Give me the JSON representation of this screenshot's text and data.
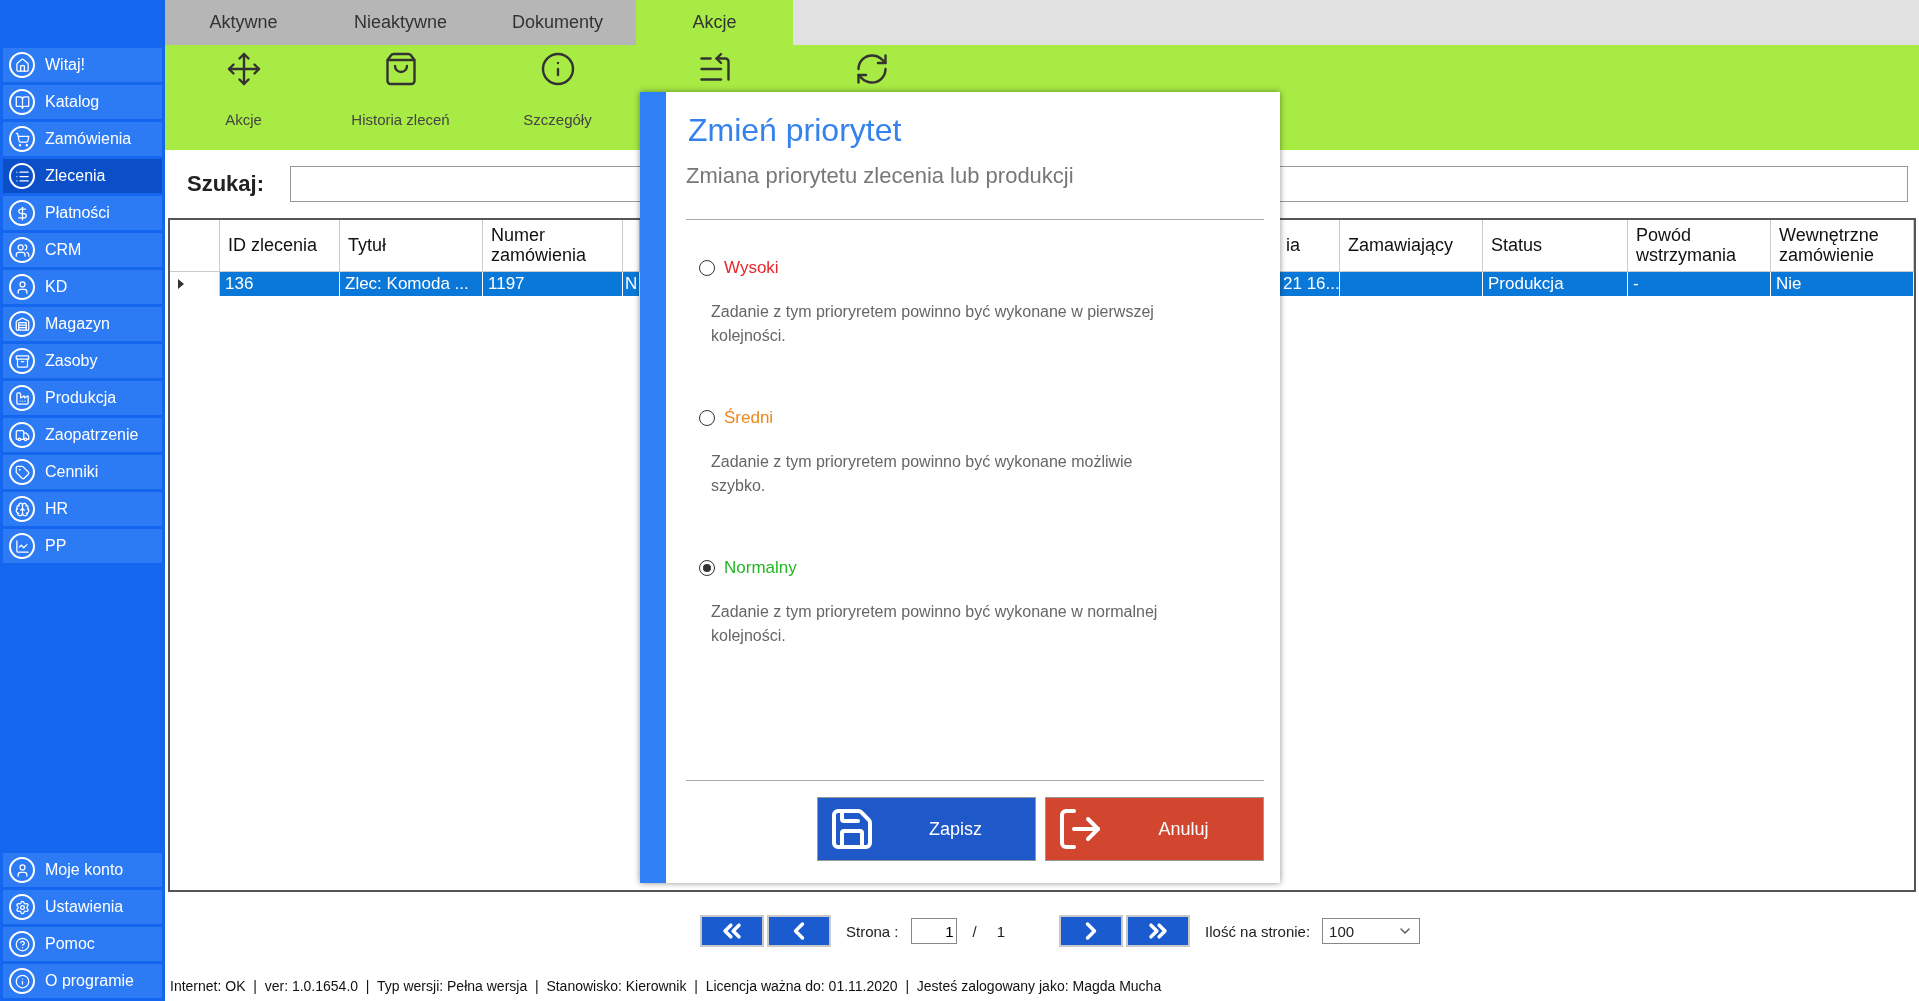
{
  "sidebar": {
    "items": [
      {
        "label": "Witaj!",
        "selected": false
      },
      {
        "label": "Katalog",
        "selected": false
      },
      {
        "label": "Zamówienia",
        "selected": false
      },
      {
        "label": "Zlecenia",
        "selected": true
      },
      {
        "label": "Płatności",
        "selected": false
      },
      {
        "label": "CRM",
        "selected": false
      },
      {
        "label": "KD",
        "selected": false
      },
      {
        "label": "Magazyn",
        "selected": false
      },
      {
        "label": "Zasoby",
        "selected": false
      },
      {
        "label": "Produkcja",
        "selected": false
      },
      {
        "label": "Zaopatrzenie",
        "selected": false
      },
      {
        "label": "Cenniki",
        "selected": false
      },
      {
        "label": "HR",
        "selected": false
      },
      {
        "label": "PP",
        "selected": false
      }
    ],
    "bottom_items": [
      {
        "label": "Moje konto",
        "selected": false
      },
      {
        "label": "Ustawienia",
        "selected": false
      },
      {
        "label": "Pomoc",
        "selected": false
      },
      {
        "label": "O programie",
        "selected": false
      }
    ]
  },
  "tabs": [
    {
      "label": "Aktywne",
      "selected": false
    },
    {
      "label": "Nieaktywne",
      "selected": false
    },
    {
      "label": "Dokumenty",
      "selected": false
    },
    {
      "label": "Akcje",
      "selected": true
    }
  ],
  "toolbar": {
    "labels": [
      "Akcje",
      "Historia zleceń",
      "Szczegóły"
    ]
  },
  "search": {
    "label": "Szukaj:"
  },
  "table": {
    "columns": [
      null,
      "ID zlecenia",
      "Tytuł",
      "Numer zamówienia",
      null,
      null,
      "ia",
      "Zamawiający",
      "Status",
      "Powód wstrzymania",
      "Wewnętrzne zamówienie"
    ],
    "rows": [
      {
        "selected": true,
        "cells": [
          null,
          "136",
          "Zlec: Komoda ...",
          "1197",
          "N",
          null,
          "21 16...",
          null,
          "Produkcja",
          "-",
          "Nie"
        ]
      }
    ]
  },
  "dialog": {
    "title": "Zmień priorytet",
    "subtitle": "Zmiana priorytetu zlecenia lub produkcji",
    "options": [
      {
        "label": "Wysoki",
        "color": "#e8262a",
        "selected": false,
        "description": "Zadanie z tym prioryretem powinno być wykonane w pierwszej kolejności."
      },
      {
        "label": "Średni",
        "color": "#f0861a",
        "selected": false,
        "description": "Zadanie z tym prioryretem powinno być wykonane możliwie szybko."
      },
      {
        "label": "Normalny",
        "color": "#22b822",
        "selected": true,
        "description": "Zadanie z tym prioryretem powinno być wykonane w normalnej kolejności."
      }
    ],
    "buttons": [
      {
        "label": "Zapisz",
        "kind": "save"
      },
      {
        "label": "Anuluj",
        "kind": "cancel"
      }
    ]
  },
  "pagination": {
    "page_label": "Strona :",
    "page": "1",
    "separator": "/",
    "total": "1",
    "per_page_label": "Ilość na stronie:",
    "per_page": "100"
  },
  "status_bar": "Internet: OK  |  ver: 1.0.1654.0  |  Typ wersji: Pełna wersja  |  Stanowisko: Kierownik  |  Licencja ważna do: 01.11.2020  |  Jesteś zalogowany jako: Magda Mucha"
}
